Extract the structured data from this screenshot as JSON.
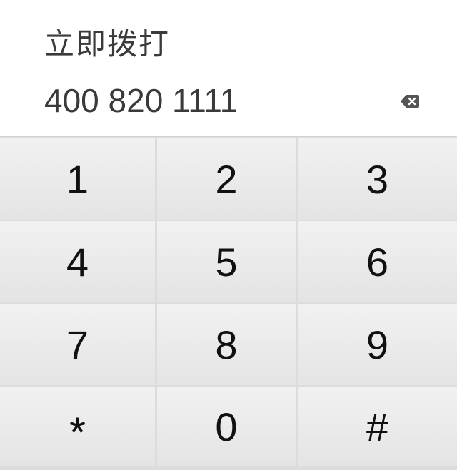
{
  "header": {
    "title": "立即拨打",
    "number": "400 820 1111"
  },
  "icons": {
    "backspace": "backspace-icon"
  },
  "keypad": {
    "keys": [
      "1",
      "2",
      "3",
      "4",
      "5",
      "6",
      "7",
      "8",
      "9",
      "*",
      "0",
      "#"
    ]
  },
  "colors": {
    "background": "#ffffff",
    "key_bg": "#eaeaea",
    "divider": "#dcdcdc",
    "text": "#3a3a3a"
  }
}
